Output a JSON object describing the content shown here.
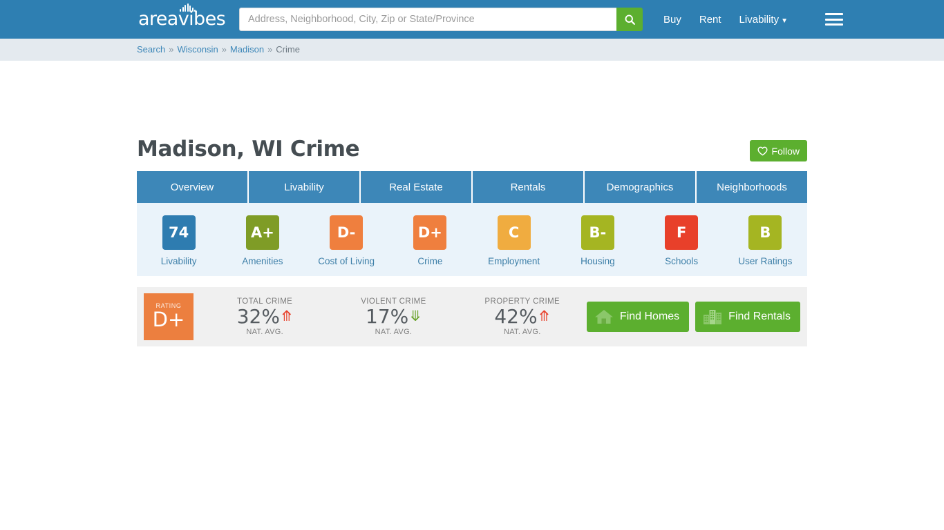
{
  "header": {
    "logo_text": "areavibes",
    "search": {
      "placeholder": "Address, Neighborhood, City, Zip or State/Province",
      "value": "",
      "button_icon": "search-icon"
    },
    "nav": [
      {
        "label": "Buy"
      },
      {
        "label": "Rent"
      },
      {
        "label": "Livability",
        "caret": "▼"
      }
    ],
    "menu_icon": "hamburger-menu-icon"
  },
  "breadcrumb": {
    "separator": "»",
    "items": [
      {
        "label": "Search",
        "link": true
      },
      {
        "label": "Wisconsin",
        "link": true
      },
      {
        "label": "Madison",
        "link": true
      },
      {
        "label": "Crime",
        "link": false
      }
    ]
  },
  "page": {
    "title": "Madison, WI Crime",
    "follow_label": "Follow",
    "follow_icon": "heart-icon"
  },
  "tabs": [
    {
      "label": "Overview"
    },
    {
      "label": "Livability"
    },
    {
      "label": "Real Estate"
    },
    {
      "label": "Rentals"
    },
    {
      "label": "Demographics"
    },
    {
      "label": "Neighborhoods"
    }
  ],
  "scores": [
    {
      "label": "Livability",
      "value": "74",
      "color": "#2e7cb0"
    },
    {
      "label": "Amenities",
      "value": "A+",
      "color": "#7f9c26"
    },
    {
      "label": "Cost of Living",
      "value": "D-",
      "color": "#ef7f3e"
    },
    {
      "label": "Crime",
      "value": "D+",
      "color": "#ef7f3e"
    },
    {
      "label": "Employment",
      "value": "C",
      "color": "#f0ac40"
    },
    {
      "label": "Housing",
      "value": "B-",
      "color": "#a5b522"
    },
    {
      "label": "Schools",
      "value": "F",
      "color": "#e8402a"
    },
    {
      "label": "User Ratings",
      "value": "B",
      "color": "#a5b522"
    }
  ],
  "crime_summary": {
    "rating": {
      "caption": "RATING",
      "grade": "D+",
      "color": "#ec7f3f"
    },
    "stats": [
      {
        "caption": "TOTAL CRIME",
        "value": "32%",
        "trend": "up",
        "sub": "NAT. AVG."
      },
      {
        "caption": "VIOLENT CRIME",
        "value": "17%",
        "trend": "down",
        "sub": "NAT. AVG."
      },
      {
        "caption": "PROPERTY CRIME",
        "value": "42%",
        "trend": "up",
        "sub": "NAT. AVG."
      }
    ],
    "actions": [
      {
        "label": "Find Homes",
        "icon": "house-icon"
      },
      {
        "label": "Find Rentals",
        "icon": "buildings-icon"
      }
    ]
  },
  "colors": {
    "brand_blue": "#2e7fb2",
    "tab_blue": "#3d87b8",
    "green": "#5caf2f",
    "up_red": "#e8402a",
    "down_green": "#6aa32b"
  }
}
